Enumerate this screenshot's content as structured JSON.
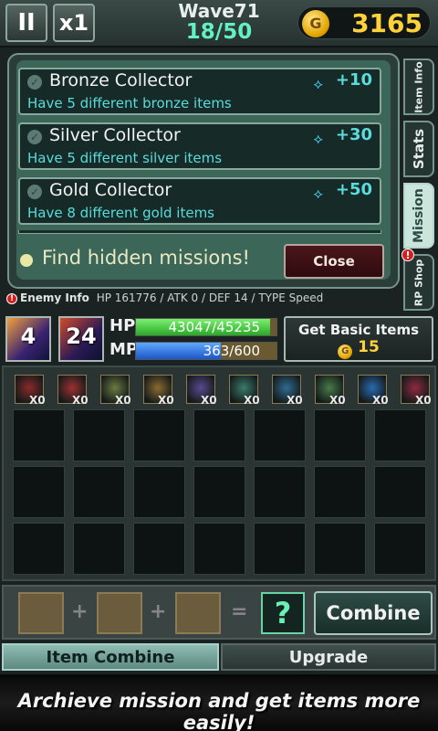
{
  "topbar": {
    "pause_label": "II",
    "speed_label": "x1",
    "wave_label": "Wave71",
    "wave_progress": "18/50",
    "gold_icon_letter": "G",
    "gold_value": "3165"
  },
  "missions": [
    {
      "title": "Bronze Collector",
      "desc": "Have 5 different bronze items",
      "reward": "+10",
      "reward_icon": "crystal-icon"
    },
    {
      "title": "Silver Collector",
      "desc": "Have 5 different silver items",
      "reward": "+30",
      "reward_icon": "crystal-icon"
    },
    {
      "title": "Gold Collector",
      "desc": "Have 8 different gold items",
      "reward": "+50",
      "reward_icon": "crystal-icon"
    }
  ],
  "hidden_missions_text": "Find hidden missions!",
  "close_label": "Close",
  "side_tabs": {
    "item_info": "Item Info",
    "stats": "Stats",
    "mission": "Mission",
    "rp_shop": "RP Shop",
    "active": "mission"
  },
  "enemy": {
    "label": "Enemy Info",
    "stats": "HP 161776 / ATK 0 / DEF 14 / TYPE Speed"
  },
  "heroes": [
    {
      "level": "4"
    },
    {
      "level": "24"
    }
  ],
  "hp": {
    "label": "HP",
    "text": "43047/45235",
    "ratio": 0.9516
  },
  "mp": {
    "label": "MP",
    "text": "363/600",
    "ratio": 0.605
  },
  "basic_items": {
    "label": "Get Basic Items",
    "coin_letter": "G",
    "cost": "15"
  },
  "inventory": {
    "items": [
      {
        "icon": "axe-icon",
        "count": "X0",
        "color": "#8a2a2a"
      },
      {
        "icon": "sword-icon",
        "count": "X0",
        "color": "#a03030"
      },
      {
        "icon": "claw-icon",
        "count": "X0",
        "color": "#6a7a40"
      },
      {
        "icon": "spear-icon",
        "count": "X0",
        "color": "#8a6a30"
      },
      {
        "icon": "dagger-icon",
        "count": "X0",
        "color": "#5a4a90"
      },
      {
        "icon": "bow-icon",
        "count": "X0",
        "color": "#3a7a6a"
      },
      {
        "icon": "trident-icon",
        "count": "X0",
        "color": "#306a90"
      },
      {
        "icon": "mace-icon",
        "count": "X0",
        "color": "#4a7a4a"
      },
      {
        "icon": "orb-icon",
        "count": "X0",
        "color": "#2a6ab0"
      },
      {
        "icon": "blade-icon",
        "count": "X0",
        "color": "#902a40"
      }
    ]
  },
  "combine": {
    "plus": "+",
    "equals": "=",
    "result_mark": "?",
    "button_label": "Combine"
  },
  "bottom_tabs": {
    "item_combine": "Item Combine",
    "upgrade": "Upgrade",
    "active": "item_combine"
  },
  "banner_text": "Archieve mission and get items more easily!"
}
